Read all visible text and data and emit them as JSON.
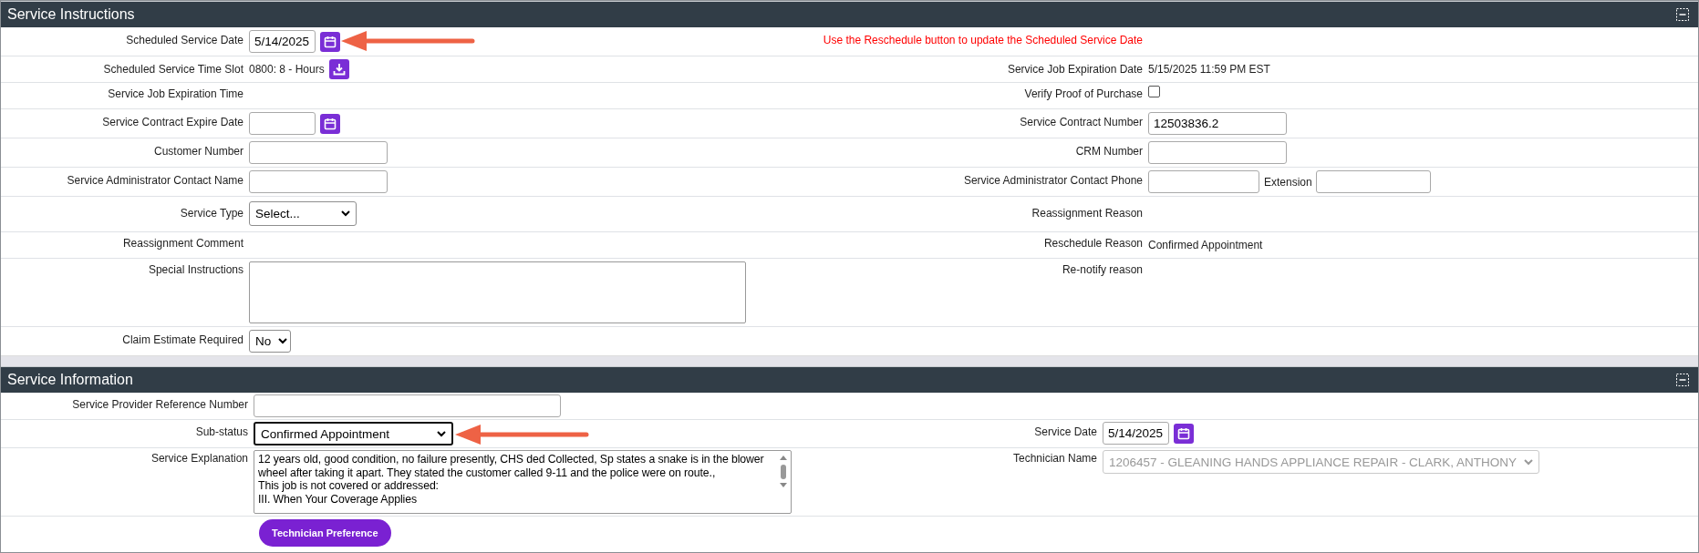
{
  "sections": [
    {
      "title": "Service Instructions",
      "expanded": true,
      "rows": [
        {
          "left": {
            "label": "Scheduled Service Date",
            "field": {
              "kind": "date",
              "value": "5/14/2025"
            }
          },
          "notice": "Use the Reschedule button to update the Scheduled Service Date"
        },
        {
          "left": {
            "label": "Scheduled Service Time Slot",
            "field": {
              "kind": "text_action",
              "value": "0800: 8 - Hours"
            }
          },
          "right": {
            "label": "Service Job Expiration Date",
            "field": {
              "kind": "text",
              "value": "5/15/2025 11:59 PM EST"
            }
          }
        },
        {
          "left": {
            "label": "Service Job Expiration Time"
          },
          "right": {
            "label": "Verify Proof of Purchase",
            "field": {
              "kind": "checkbox",
              "checked": false
            }
          }
        },
        {
          "left": {
            "label": "Service Contract Expire Date",
            "field": {
              "kind": "date"
            }
          },
          "right": {
            "label": "Service Contract Number",
            "field": {
              "kind": "input",
              "value": "12503836.2"
            }
          }
        },
        {
          "left": {
            "label": "Customer Number",
            "field": {
              "kind": "input"
            }
          },
          "right": {
            "label": "CRM Number",
            "field": {
              "kind": "input"
            }
          }
        },
        {
          "left": {
            "label": "Service Administrator Contact Name",
            "field": {
              "kind": "input"
            }
          },
          "right": {
            "label": "Service Administrator Contact Phone",
            "field": {
              "kind": "phone",
              "extension_label": "Extension"
            }
          }
        },
        {
          "left": {
            "label": "Service Type",
            "field": {
              "kind": "select",
              "value": "Select...",
              "focused": false,
              "disabled": false
            }
          },
          "right": {
            "label": "Reassignment Reason"
          }
        },
        {
          "left": {
            "label": "Reassignment Comment"
          },
          "right": {
            "label": "Reschedule Reason",
            "field": {
              "kind": "text",
              "value": "Confirmed Appointment"
            }
          }
        },
        {
          "left": {
            "label": "Special Instructions",
            "field": {
              "kind": "textarea"
            }
          },
          "right": {
            "label": "Re-notify reason"
          }
        },
        {
          "left": {
            "label": "Claim Estimate Required",
            "field": {
              "kind": "select",
              "value": "No",
              "focused": false,
              "disabled": false
            }
          }
        }
      ]
    },
    {
      "title": "Service Information",
      "expanded": true,
      "rows": [
        {
          "left": {
            "label": "Service Provider Reference Number",
            "field": {
              "kind": "long_input"
            }
          }
        },
        {
          "left": {
            "label": "Sub-status",
            "field": {
              "kind": "wide_select",
              "value": "Confirmed Appointment",
              "focused": true,
              "disabled": false
            }
          },
          "right": {
            "label": "Service Date",
            "field": {
              "kind": "date",
              "value": "5/14/2025"
            }
          }
        },
        {
          "left": {
            "label": "Service Explanation",
            "field": {
              "kind": "textarea",
              "lines": [
                "12 years old, good condition, no failure presently, CHS ded Collected, Sp states a snake is in the blower wheel after taking it apart. They stated the customer called 9-11 and the police were on route.,",
                "This job is not covered or addressed:",
                "III. When Your Coverage Applies"
              ]
            }
          },
          "right": {
            "label": "Technician Name",
            "field": {
              "kind": "wide_select",
              "value": "1206457 - GLEANING HANDS APPLIANCE REPAIR - CLARK, ANTHONY",
              "focused": false,
              "disabled": true
            }
          }
        },
        {
          "left": {
            "field": {
              "kind": "button",
              "label": "Technician Preference"
            }
          }
        }
      ]
    }
  ]
}
